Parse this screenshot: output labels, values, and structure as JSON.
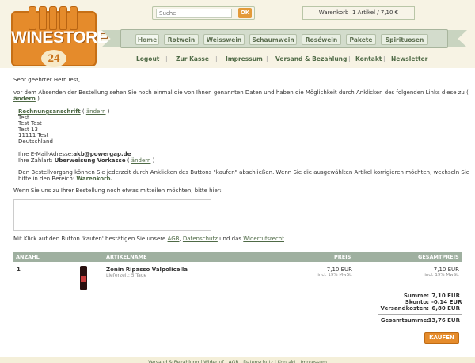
{
  "logo": {
    "title": "WINESTORE",
    "number": "24"
  },
  "search": {
    "placeholder": "Suche",
    "button": "OK"
  },
  "cart": {
    "label": "Warenkorb",
    "summary": "1 Artikel / 7,10 €"
  },
  "nav": {
    "items": [
      {
        "label": "Home"
      },
      {
        "label": "Rotwein"
      },
      {
        "label": "Weisswein"
      },
      {
        "label": "Schaumwein"
      },
      {
        "label": "Roséwein"
      },
      {
        "label": "Pakete"
      },
      {
        "label": "Spirituosen"
      }
    ]
  },
  "subnav": {
    "items": [
      {
        "label": "Logout"
      },
      {
        "label": "Zur Kasse"
      },
      {
        "label": "Impressum"
      },
      {
        "label": "Versand & Bezahlung"
      },
      {
        "label": "Kontakt"
      },
      {
        "label": "Newsletter"
      }
    ]
  },
  "greeting": "Sehr geehrter Herr Test,",
  "intro": {
    "line1": "vor dem Absenden der Bestellung sehen Sie noch einmal die von Ihnen genannten Daten und haben die Möglichkeit durch Anklicken des folgenden Links diese zu (",
    "link": "ändern",
    "close": ")"
  },
  "billing": {
    "heading": "Rechnungsanschrift",
    "edit": "ändern",
    "lines": [
      "Test",
      "Test Test",
      "Test 13",
      "11111 Test",
      "Deutschland"
    ]
  },
  "email": {
    "label": "Ihre E-Mail-Adresse:",
    "value": "akb@powergap.de"
  },
  "payment": {
    "label": "Ihre Zahlart:",
    "value": "Überweisung Vorkasse",
    "edit": "ändern"
  },
  "notice": {
    "line1": "Den Bestellvorgang können Sie jederzeit durch Anklicken des Buttons \"kaufen\" abschließen. Wenn Sie die ausgewählten Artikel korrigieren möchten, wechseln Sie",
    "line2": "bitte in den Bereich:",
    "link": "Warenkorb."
  },
  "comment_prompt": "Wenn Sie uns zu Ihrer Bestellung noch etwas mitteilen möchten, bitte hier:",
  "terms": {
    "prefix": "Mit Klick auf den Button 'kaufen' bestätigen Sie unsere",
    "agb": "AGB",
    "sep": ",",
    "datenschutz": "Datenschutz",
    "und": "und das",
    "widerruf": "Widerrufsrecht",
    "end": "."
  },
  "table": {
    "headers": {
      "qty": "ANZAHL",
      "name": "ARTIKELNAME",
      "price": "PREIS",
      "total": "GESAMTPREIS"
    },
    "rows": [
      {
        "qty": "1",
        "name": "Zonin Ripasso Valpolicella",
        "delivery": "Lieferzeit: 5 Tage",
        "price": "7,10 EUR",
        "price_note": "incl. 19% MwSt.",
        "total": "7,10 EUR",
        "total_note": "incl. 19% MwSt."
      }
    ]
  },
  "summary": {
    "rows": [
      {
        "label": "Summe:",
        "value": "7,10 EUR"
      },
      {
        "label": "Skonto:",
        "value": "-0,14 EUR"
      },
      {
        "label": "Versandkosten:",
        "value": "6,80 EUR"
      }
    ],
    "total_label": "Gesamtsumme:",
    "total_value": "13,76 EUR"
  },
  "buy_button": "KAUFEN",
  "footer": "Versand & Bezahlung | Widerruf | AGB | Datenschutz | Kontakt | Impressum"
}
